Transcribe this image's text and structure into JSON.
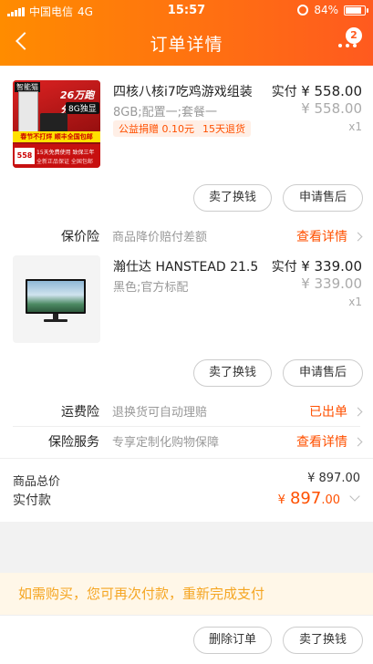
{
  "status_bar": {
    "carrier": "中国电信",
    "network": "4G",
    "time": "15:57",
    "battery": "84%"
  },
  "header": {
    "title": "订单详情",
    "badge_count": "2"
  },
  "item1": {
    "name": "四核八核i7吃鸡游戏组装",
    "spec": "8GB;配置一;套餐一",
    "tags": [
      "公益捐赠 0.10元",
      "15天退货"
    ],
    "paid_label": "实付",
    "paid_value": "¥ 558.00",
    "orig_price": "¥ 558.00",
    "qty": "x1",
    "thumb": {
      "brand": "智能猫",
      "promo_top": "26万跑分",
      "promo_mem": "8G独显",
      "banner": "春节不打烊 顺丰全国包邮",
      "price": "558",
      "footer": "15天免费使用 致保三年",
      "footer2": "全新正品保证 全国包邮"
    },
    "buttons": {
      "resell": "卖了换钱",
      "after_sale": "申请售后"
    }
  },
  "price_protect": {
    "label": "保价险",
    "desc": "商品降价赔付差额",
    "action": "查看详情"
  },
  "item2": {
    "name": "瀚仕达 HANSTEAD 21.5",
    "spec": "黑色;官方标配",
    "paid_label": "实付",
    "paid_value": "¥ 339.00",
    "orig_price": "¥ 339.00",
    "qty": "x1",
    "buttons": {
      "resell": "卖了换钱",
      "after_sale": "申请售后"
    }
  },
  "shipping_ins": {
    "label": "运费险",
    "desc": "退换货可自动理赔",
    "action": "已出单"
  },
  "insurance_service": {
    "label": "保险服务",
    "desc": "专享定制化购物保障",
    "action": "查看详情"
  },
  "totals": {
    "goods_total_label": "商品总价",
    "goods_total_value": "¥ 897.00",
    "paid_label": "实付款",
    "paid_currency": "¥",
    "paid_int": "897",
    "paid_dec": ".00"
  },
  "notice": "如需购买，您可再次付款，重新完成支付",
  "footer": {
    "delete_order": "删除订单",
    "resell": "卖了换钱"
  },
  "colors": {
    "accent": "#ff5000",
    "header_start": "#ff8c00",
    "header_end": "#ff5a1f",
    "notice_bg": "#fff7e8",
    "notice_text": "#f5a623"
  }
}
